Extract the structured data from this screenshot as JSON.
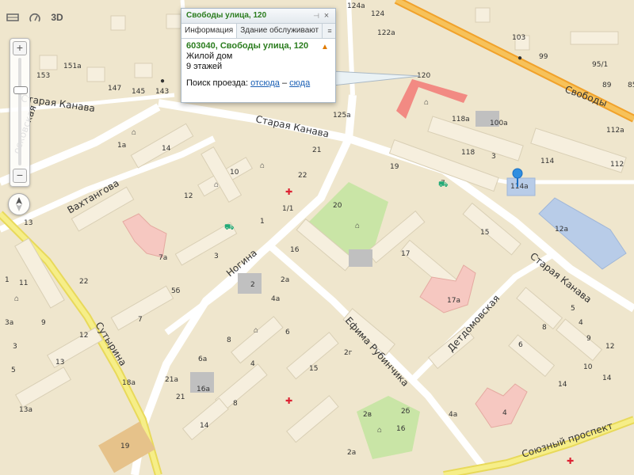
{
  "controls": {
    "layers_label": "",
    "traffic_label": "",
    "view3d_label": "3D",
    "zoom_in": "+",
    "zoom_out": "−"
  },
  "popup": {
    "title": "Свободы улица, 120",
    "tab_info": "Информация",
    "tab_service": "Здание обслуживают",
    "menu": "≡",
    "pin": "⊣",
    "close": "×",
    "address": "603040, Свободы улица, 120",
    "type": "Жилой дом",
    "floors": "9 этажей",
    "route_label": "Поиск проезда:",
    "route_from": "отсюда",
    "route_dash": "–",
    "route_to": "сюда"
  },
  "streets": {
    "svobody": "Свободы",
    "staraya_kanava_top": "Старая Канава",
    "staraya_kanava_mid": "Старая Канава",
    "staraya_kanava_right": "Старая Канава",
    "vakhtangova": "Вахтангова",
    "nogina": "Ногина",
    "sutyrina": "Сутырина",
    "efima": "Ефима Рубинчика",
    "detdomovskaya": "Детдомовская",
    "soyuzny": "Союзный проспект",
    "moskovskaya": "осковская"
  },
  "house_numbers": {
    "h120": "120",
    "h118a": "118а",
    "h100a": "100а",
    "h118": "118",
    "h114": "114",
    "h114a": "114а",
    "h112": "112",
    "h112a": "112а",
    "h12a": "12а",
    "h103": "103",
    "h99": "99",
    "h95": "95/1",
    "h89": "89",
    "h85": "85",
    "h125a": "125а",
    "h124a": "124а",
    "h122a": "122а",
    "h124": "124",
    "h143": "143",
    "h145": "145",
    "h147": "147",
    "h151a": "151а",
    "h153": "153",
    "h1a": "1а",
    "h14a": "14",
    "h21": "21",
    "h10": "10",
    "h22": "22",
    "h11": "1/1",
    "h12": "12",
    "h1": "1",
    "h7a": "7а",
    "h3": "3",
    "h5b": "5б",
    "h19": "19",
    "h20": "20",
    "h17": "17",
    "h15": "15",
    "h16": "16",
    "h17a": "17а",
    "h2": "2",
    "h2a": "2а",
    "h4a": "4а",
    "h22b": "22",
    "h7": "7",
    "h6a": "6а",
    "h8": "8",
    "h6": "6",
    "h4": "4",
    "h2g": "2г",
    "h2v": "2в",
    "h2b": "2б",
    "h15b": "15",
    "h21a": "21а",
    "h16a": "16а",
    "h18a": "18а",
    "h13": "13",
    "h13a": "13а",
    "h19b": "19",
    "h14b": "14",
    "h4ab": "4а",
    "h2ab": "2а",
    "h4b": "4",
    "h14c": "14",
    "h8b": "8",
    "h6b": "6",
    "h12b": "12",
    "h10b": "10",
    "h8c": "8",
    "h3a": "3а",
    "h11b": "11",
    "h9": "9",
    "h5": "5",
    "h1b": "1",
    "h3b": "3",
    "h4c": "4",
    "h5c": "5",
    "h9b": "9",
    "h12c": "12",
    "h13b": "13",
    "h14d": "14",
    "h16b": "16",
    "h3c": "3",
    "h7b": "7"
  }
}
